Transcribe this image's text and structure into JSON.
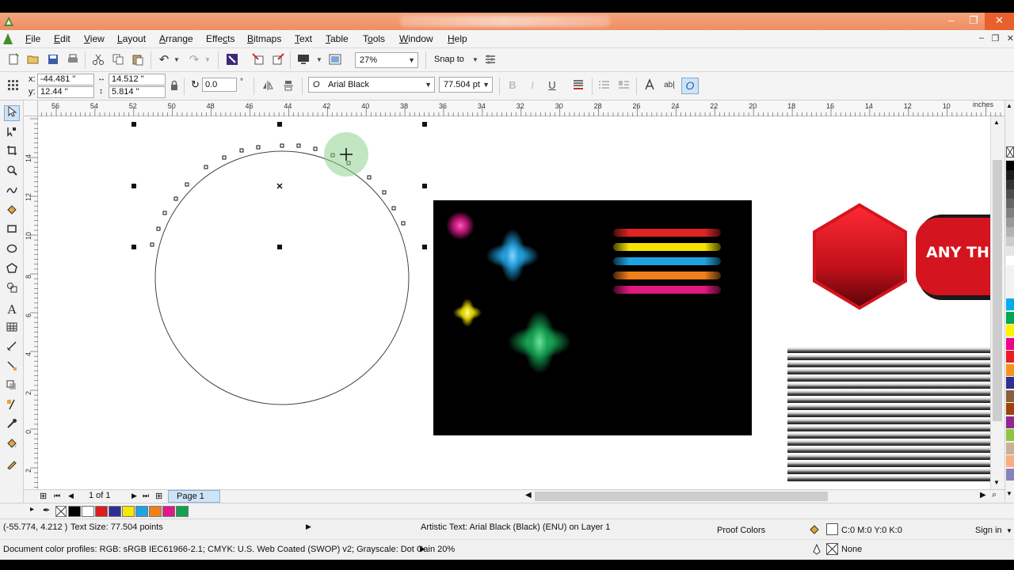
{
  "window": {
    "minimize_glyph": "–",
    "restore_glyph": "❐",
    "close_glyph": "✕",
    "inner_controls": [
      "–",
      "❐",
      "✕"
    ]
  },
  "menu": [
    {
      "label": "File",
      "accel": "F"
    },
    {
      "label": "Edit",
      "accel": "E"
    },
    {
      "label": "View",
      "accel": "V"
    },
    {
      "label": "Layout",
      "accel": "L"
    },
    {
      "label": "Arrange",
      "accel": "A"
    },
    {
      "label": "Effects",
      "accel": "c"
    },
    {
      "label": "Bitmaps",
      "accel": "B"
    },
    {
      "label": "Text",
      "accel": "T"
    },
    {
      "label": "Table",
      "accel": "T"
    },
    {
      "label": "Tools",
      "accel": "o"
    },
    {
      "label": "Window",
      "accel": "W"
    },
    {
      "label": "Help",
      "accel": "H"
    }
  ],
  "standard_toolbar": {
    "zoom_level": "27%",
    "snap_to_label": "Snap to"
  },
  "property_bar": {
    "x_label": "x:",
    "x_value": "-44.481 \"",
    "y_label": "y:",
    "y_value": "12.44 \"",
    "width_value": "14.512 \"",
    "height_value": "5.814 \"",
    "rotation_value": "0.0",
    "rotation_unit": "°",
    "font_name": "Arial Black",
    "font_size": "77.504 pt"
  },
  "rulers": {
    "horizontal_labels": [
      "56",
      "54",
      "52",
      "50",
      "48",
      "46",
      "44",
      "42",
      "40",
      "38",
      "36",
      "34",
      "32",
      "30",
      "28",
      "26",
      "24",
      "22",
      "20",
      "18",
      "16",
      "14",
      "12",
      "10"
    ],
    "units": "inches",
    "vertical_labels": [
      "14",
      "12",
      "10",
      "8",
      "6",
      "4",
      "2",
      "0",
      "2"
    ]
  },
  "page_navigator": {
    "page_count": "1 of 1",
    "page_tab": "Page 1"
  },
  "canvas": {
    "badge_text": "ANY TH",
    "stripe_colors": [
      "#e02424",
      "#f5e400",
      "#1fa3e0",
      "#f07f1a",
      "#e0187f"
    ],
    "flower_colors": [
      "#e0188a",
      "#1e9ad8",
      "#e6d800",
      "#14a050"
    ],
    "hex_color": "#d4141e"
  },
  "document_palette": {
    "colors": [
      "#000000",
      "#ffffff",
      "#d81e1e",
      "#2e3092",
      "#f5e800",
      "#1fa3e0",
      "#f07f1a",
      "#e0188a",
      "#14a050"
    ]
  },
  "color_palette": {
    "colors": [
      "#000000",
      "#1a1a1a",
      "#333333",
      "#4d4d4d",
      "#666666",
      "#808080",
      "#999999",
      "#b3b3b3",
      "#cccccc",
      "#e6e6e6",
      "#ffffff",
      "#00aeef",
      "#00a651",
      "#fff200",
      "#ec008c",
      "#ed1c24",
      "#f7941d",
      "#2e3192",
      "#8b5e3c",
      "#a0410d",
      "#92278f",
      "#8dc63f",
      "#c7b299",
      "#f9ad81",
      "#8781bd"
    ]
  },
  "status": {
    "coordinates": "(-55.774, 4.212 )",
    "text_size": "Text Size: 77.504 points",
    "object_info": "Artistic Text: Arial Black (Black) (ENU) on Layer 1",
    "proof_colors": "Proof Colors",
    "fill_info": "C:0 M:0 Y:0 K:0",
    "sign_in": "Sign in",
    "color_profiles": "Document color profiles: RGB: sRGB IEC61966-2.1; CMYK: U.S. Web Coated (SWOP) v2; Grayscale: Dot Gain 20%",
    "outline_info": "None"
  }
}
